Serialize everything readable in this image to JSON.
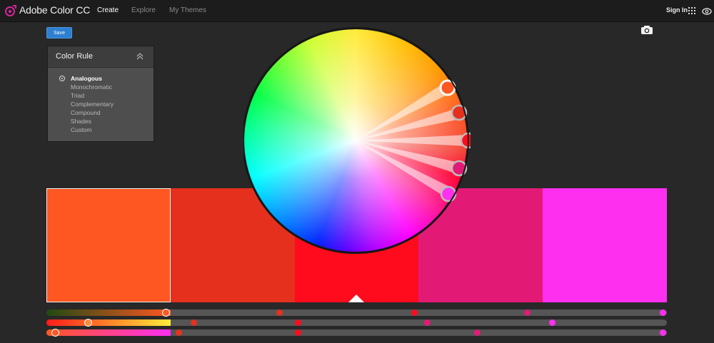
{
  "app": {
    "title": "Adobe Color CC",
    "nav": [
      {
        "label": "Create",
        "active": true
      },
      {
        "label": "Explore",
        "active": false
      },
      {
        "label": "My Themes",
        "active": false
      }
    ],
    "sign_in": "Sign In",
    "icons": {
      "logo": "adobe-color-logo-icon",
      "apps": "apps-grid-icon",
      "cc": "creative-cloud-icon",
      "camera": "camera-icon"
    }
  },
  "toolbar": {
    "save_label": "Save"
  },
  "color_rule": {
    "title": "Color Rule",
    "options": [
      {
        "label": "Analogous",
        "selected": true
      },
      {
        "label": "Monochromatic",
        "selected": false
      },
      {
        "label": "Triad",
        "selected": false
      },
      {
        "label": "Complementary",
        "selected": false
      },
      {
        "label": "Compound",
        "selected": false
      },
      {
        "label": "Shades",
        "selected": false
      },
      {
        "label": "Custom",
        "selected": false
      }
    ]
  },
  "swatches": [
    {
      "color": "#ff5722",
      "selected": true
    },
    {
      "color": "#e5301e",
      "selected": false
    },
    {
      "color": "#ff0b1d",
      "selected": false
    },
    {
      "color": "#e31a75",
      "selected": false
    },
    {
      "color": "#ff2ff0",
      "selected": false
    }
  ],
  "selected_swatch": 0,
  "colors": {
    "accent_blue": "#2d7fd0",
    "background": "#282828",
    "topbar": "#1c1c1c"
  }
}
